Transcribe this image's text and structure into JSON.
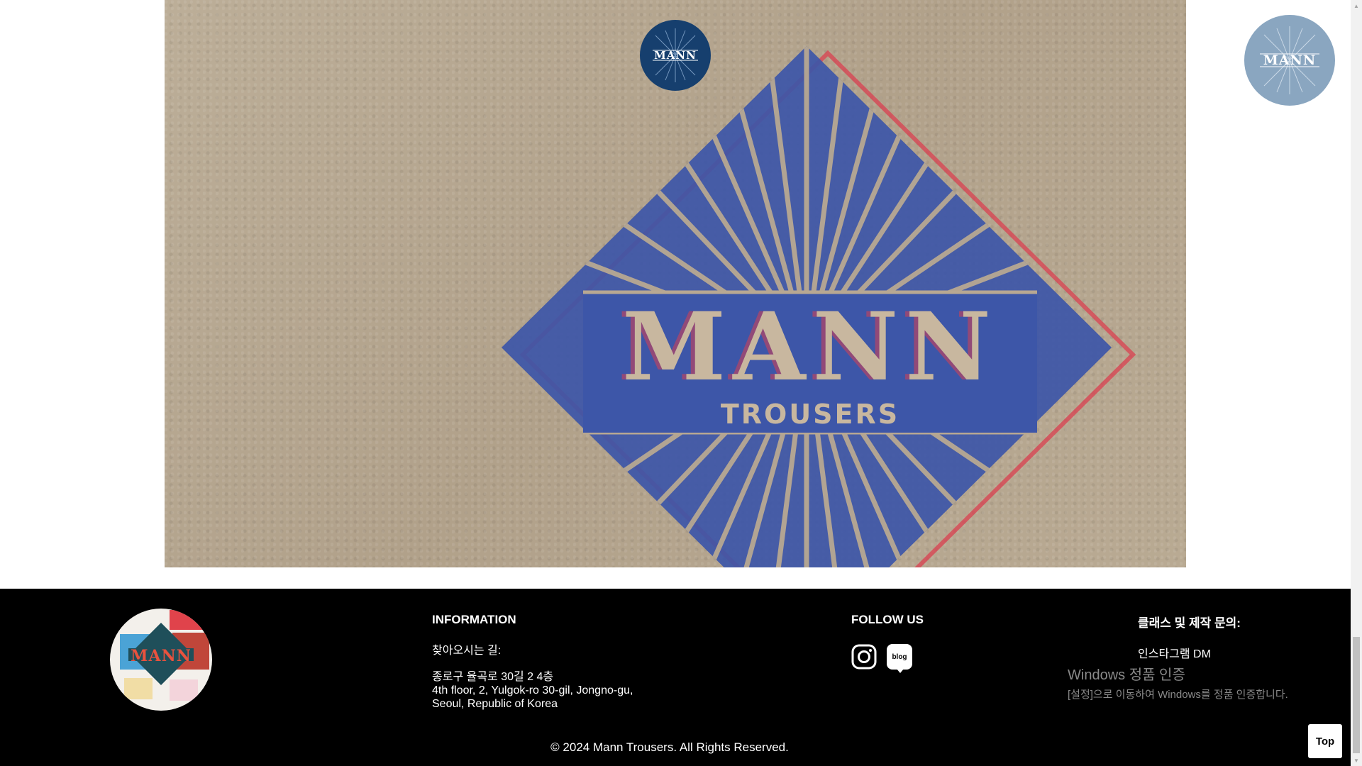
{
  "hero": {
    "stamp_text": "MANN",
    "stamp_subtext": "TROUSERS"
  },
  "logo": {
    "text": "MANN"
  },
  "footer": {
    "information": {
      "heading": "INFORMATION",
      "directions_label": "찾아오시는 길:",
      "address_korean": "종로구 율곡로 30길 2 4층",
      "address_en_line1": "4th floor, 2, Yulgok-ro 30-gil, Jongno-gu,",
      "address_en_line2": "Seoul, Republic of Korea"
    },
    "follow": {
      "heading": "FOLLOW US",
      "blog_label": "blog"
    },
    "contact": {
      "heading": "클래스 및 제작 문의:",
      "instagram_dm": "인스타그램 DM"
    },
    "copyright": "© 2024 Mann Trousers. All Rights Reserved."
  },
  "watermark": {
    "title": "Windows 정품 인증",
    "subtitle": "[설정]으로 이동하여 Windows를 정품 인증합니다."
  },
  "top_button": {
    "label": "Top"
  },
  "colors": {
    "stamp_blue": "#3d56a8",
    "stamp_red": "#d94050",
    "logo_navy": "#163f6e",
    "logo_light": "#8aa6c0",
    "footer_bg": "#000000"
  }
}
